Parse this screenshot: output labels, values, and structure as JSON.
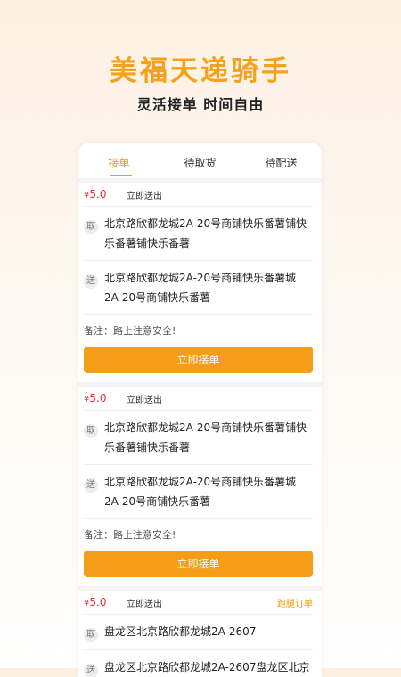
{
  "hero": {
    "title": "美福天递骑手",
    "subtitle": "灵活接单 时间自由"
  },
  "tabs": [
    {
      "label": "接单",
      "active": true
    },
    {
      "label": "待取货",
      "active": false
    },
    {
      "label": "待配送",
      "active": false
    }
  ],
  "orders": [
    {
      "currency": "¥",
      "price": "5.0",
      "mode": "立即送出",
      "tag": "",
      "pickup_badge": "取",
      "pickup": "北京路欣都龙城2A-20号商铺快乐番薯铺快乐番薯铺快乐番薯",
      "deliver_badge": "送",
      "deliver": "北京路欣都龙城2A-20号商铺快乐番薯城2A-20号商铺快乐番薯",
      "note": "备注：路上注意安全!",
      "button": "立即接单"
    },
    {
      "currency": "¥",
      "price": "5.0",
      "mode": "立即送出",
      "tag": "",
      "pickup_badge": "取",
      "pickup": "北京路欣都龙城2A-20号商铺快乐番薯铺快乐番薯铺快乐番薯",
      "deliver_badge": "送",
      "deliver": "北京路欣都龙城2A-20号商铺快乐番薯城2A-20号商铺快乐番薯",
      "note": "备注：路上注意安全!",
      "button": "立即接单"
    },
    {
      "currency": "¥",
      "price": "5.0",
      "mode": "立即送出",
      "tag": "跑腿订单",
      "pickup_badge": "取",
      "pickup": "盘龙区北京路欣都龙城2A-2607",
      "deliver_badge": "送",
      "deliver": "盘龙区北京路欣都龙城2A-2607盘龙区北京"
    }
  ],
  "colors": {
    "accent": "#f39a11",
    "price": "#e52e2e",
    "button": "#f59d17"
  }
}
